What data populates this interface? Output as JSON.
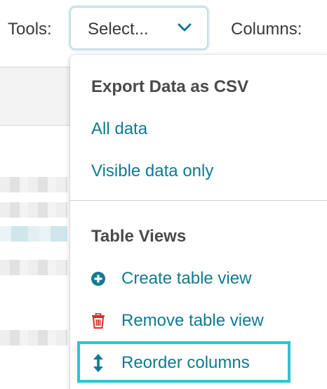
{
  "toolbar": {
    "tools_label": "Tools:",
    "select_value": "Select...",
    "columns_label": "Columns:"
  },
  "menu": {
    "export_heading": "Export Data as CSV",
    "export_items": [
      {
        "label": "All data"
      },
      {
        "label": "Visible data only"
      }
    ],
    "views_heading": "Table Views",
    "view_actions": [
      {
        "label": "Create table view",
        "icon": "plus-circle-icon"
      },
      {
        "label": "Remove table view",
        "icon": "trash-icon"
      },
      {
        "label": "Reorder columns",
        "icon": "vertical-arrows-icon"
      }
    ],
    "highlighted_item": "Reorder columns"
  },
  "colors": {
    "link": "#107a92",
    "remove_icon": "#d0312d",
    "highlight": "#2fc3d3",
    "heading": "#4a4a4a"
  }
}
